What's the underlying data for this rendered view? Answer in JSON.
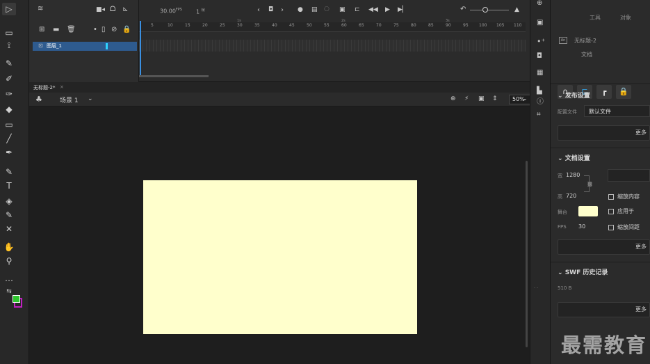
{
  "timeline": {
    "fps": "30.00",
    "fps_unit": "FPS",
    "frame": "1",
    "frame_unit": "帧",
    "layer_name": "图层_1",
    "ruler_ticks": [
      "5",
      "10",
      "15",
      "20",
      "25",
      "30",
      "35",
      "40",
      "45",
      "50",
      "55",
      "60",
      "65",
      "70",
      "75",
      "80",
      "85",
      "90",
      "95",
      "100",
      "105",
      "110"
    ],
    "second_marks": [
      "1s",
      "2s",
      "3s"
    ]
  },
  "document": {
    "tab_title": "无标题-2*",
    "tab_close": "×",
    "scene": "场景 1",
    "zoom": "50%"
  },
  "stage": {
    "background_color": "#ffffcc",
    "width": 1280,
    "height": 720
  },
  "properties": {
    "tab_tools": "工具",
    "tab_object": "对象",
    "doc_name": "无标题-2",
    "doc_type": "文档",
    "publish_section": "发布设置",
    "profile_label": "配置文件",
    "profile_value": "默认文件",
    "more_label_1": "更多",
    "doc_section": "文档设置",
    "width_label": "宽",
    "width_value": "1280",
    "height_label": "高",
    "height_value": "720",
    "scale_content": "缩放内容",
    "stage_label": "舞台",
    "apply_to": "应用于",
    "fps_label": "FPS",
    "fps_value": "30",
    "scale_spacing": "缩放间距",
    "more_label_2": "更多",
    "swf_section": "SWF 历史记录",
    "swf_size": "510 B",
    "more_label_3": "更多"
  },
  "watermark": "最需教育",
  "colors": {
    "accent": "#2e5b8f",
    "playhead": "#3a8fe0",
    "stage": "#ffffcc",
    "fill_swatch": "#2ec52e",
    "stroke_swatch": "#c020c0"
  }
}
